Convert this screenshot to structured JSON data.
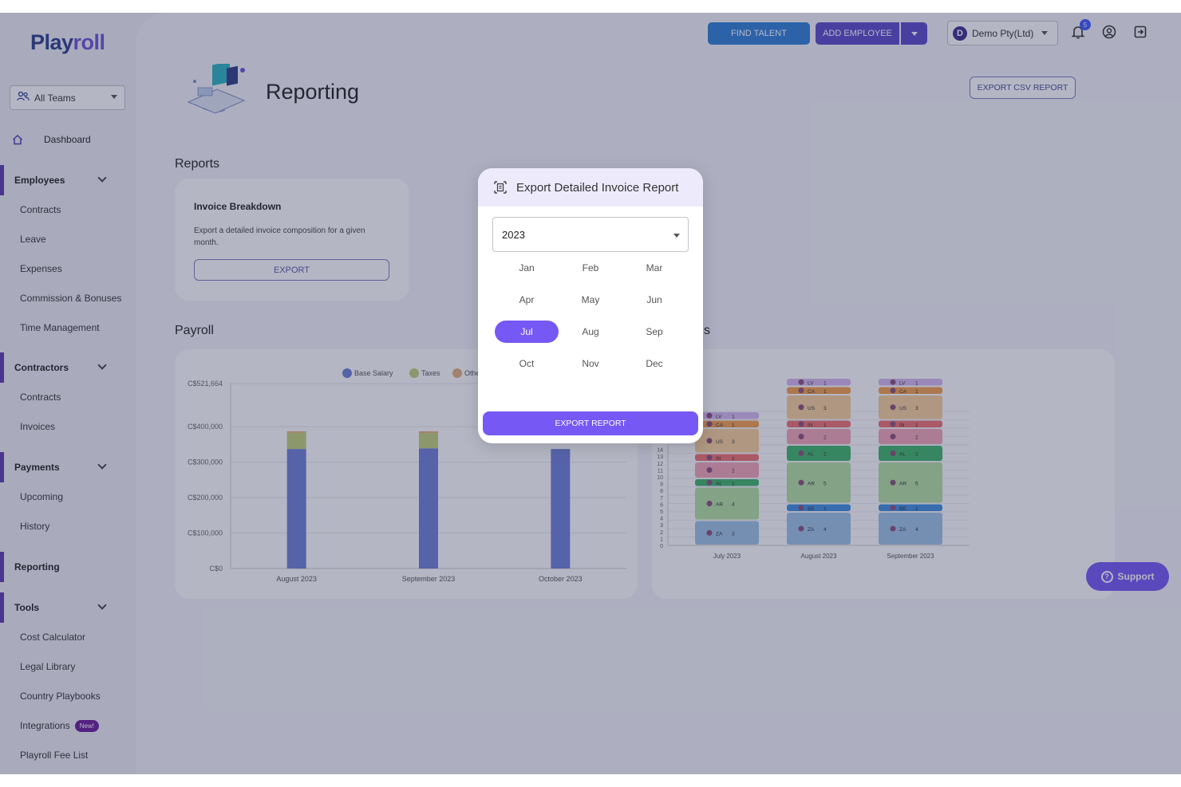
{
  "app": {
    "logo_main": "Play",
    "logo_accent": "roll"
  },
  "sidebar": {
    "team_select": "All Teams",
    "dashboard": "Dashboard",
    "sections": [
      {
        "label": "Employees",
        "items": [
          "Contracts",
          "Leave",
          "Expenses",
          "Commission & Bonuses",
          "Time Management"
        ]
      },
      {
        "label": "Contractors",
        "items": [
          "Contracts",
          "Invoices"
        ]
      },
      {
        "label": "Payments",
        "items": [
          "Upcoming",
          "History"
        ]
      },
      {
        "label": "Reporting",
        "items": []
      },
      {
        "label": "Tools",
        "items": [
          "Cost Calculator",
          "Legal Library",
          "Country Playbooks",
          "Integrations",
          "Playroll Fee List"
        ]
      }
    ],
    "new_badge": "New!"
  },
  "topbar": {
    "find_talent": "FIND TALENT",
    "add_employee": "ADD EMPLOYEE",
    "company_initial": "D",
    "company": "Demo Pty(Ltd)",
    "notification_count": "5",
    "colors": {
      "find_talent": "#2f7fd6",
      "add_employee": "#5b49c9"
    }
  },
  "page": {
    "title": "Reporting",
    "export_csv": "EXPORT CSV REPORT",
    "reports_heading": "Reports",
    "payroll_heading": "Payroll",
    "second_heading_fragment": "s"
  },
  "invoice_card": {
    "title": "Invoice Breakdown",
    "description": "Export a detailed invoice composition for a given month.",
    "button": "EXPORT"
  },
  "support": {
    "label": "Support"
  },
  "modal": {
    "title": "Export Detailed Invoice Report",
    "year": "2023",
    "months": [
      "Jan",
      "Feb",
      "Mar",
      "Apr",
      "May",
      "Jun",
      "Jul",
      "Aug",
      "Sep",
      "Oct",
      "Nov",
      "Dec"
    ],
    "selected_month": "Jul",
    "export_button": "EXPORT REPORT"
  },
  "chart_data": [
    {
      "type": "bar",
      "stacked": true,
      "categories": [
        "August 2023",
        "September 2023",
        "October 2023"
      ],
      "series": [
        {
          "name": "Base Salary",
          "color": "#6f80d8",
          "values": [
            337000,
            339000,
            337000
          ]
        },
        {
          "name": "Taxes",
          "color": "#c3cf7a",
          "values": [
            46000,
            43000,
            0
          ]
        },
        {
          "name": "Other",
          "color": "#e3b07a",
          "values": [
            4000,
            5000,
            0
          ]
        }
      ],
      "yticks": [
        "C$0",
        "C$100,000",
        "C$200,000",
        "C$300,000",
        "C$400,000",
        "C$521,664"
      ],
      "ylim": [
        0,
        521664
      ],
      "legend": "top-center",
      "grid": true
    },
    {
      "type": "bar",
      "stacked": true,
      "categories": [
        "July 2023",
        "August 2023",
        "September 2023"
      ],
      "yticks": [
        "0",
        "1",
        "2",
        "3",
        "4",
        "5",
        "6",
        "7",
        "8",
        "9",
        "10",
        "11",
        "12",
        "13",
        "14"
      ],
      "stacks": [
        [
          {
            "code": "ZA",
            "count": 3,
            "color": "#9ec3e6"
          },
          {
            "code": "AR",
            "count": 4,
            "color": "#b5e0a0"
          },
          {
            "code": "AL",
            "count": 1,
            "color": "#3fb56a"
          },
          {
            "code": "",
            "count": 2,
            "color": "#f2a6b6"
          },
          {
            "code": "IN",
            "count": 1,
            "color": "#f07070"
          },
          {
            "code": "US",
            "count": 3,
            "color": "#f7cf9a"
          },
          {
            "code": "CA",
            "count": 1,
            "color": "#f5a04a"
          },
          {
            "code": "LV",
            "count": 1,
            "color": "#d6b8f0"
          }
        ],
        [
          {
            "code": "ZA",
            "count": 4,
            "color": "#9ec3e6"
          },
          {
            "code": "BE",
            "count": 1,
            "color": "#3f8ee0"
          },
          {
            "code": "AR",
            "count": 5,
            "color": "#b5e0a0"
          },
          {
            "code": "AL",
            "count": 2,
            "color": "#3fb56a"
          },
          {
            "code": "",
            "count": 2,
            "color": "#f2a6b6"
          },
          {
            "code": "IN",
            "count": 1,
            "color": "#f07070"
          },
          {
            "code": "US",
            "count": 3,
            "color": "#f7cf9a"
          },
          {
            "code": "CA",
            "count": 1,
            "color": "#f5a04a"
          },
          {
            "code": "LV",
            "count": 1,
            "color": "#d6b8f0"
          }
        ],
        [
          {
            "code": "ZA",
            "count": 4,
            "color": "#9ec3e6"
          },
          {
            "code": "BE",
            "count": 1,
            "color": "#3f8ee0"
          },
          {
            "code": "AR",
            "count": 5,
            "color": "#b5e0a0"
          },
          {
            "code": "AL",
            "count": 2,
            "color": "#3fb56a"
          },
          {
            "code": "",
            "count": 2,
            "color": "#f2a6b6"
          },
          {
            "code": "IN",
            "count": 1,
            "color": "#f07070"
          },
          {
            "code": "US",
            "count": 3,
            "color": "#f7cf9a"
          },
          {
            "code": "CA",
            "count": 1,
            "color": "#f5a04a"
          },
          {
            "code": "LV",
            "count": 1,
            "color": "#d6b8f0"
          }
        ]
      ]
    }
  ]
}
